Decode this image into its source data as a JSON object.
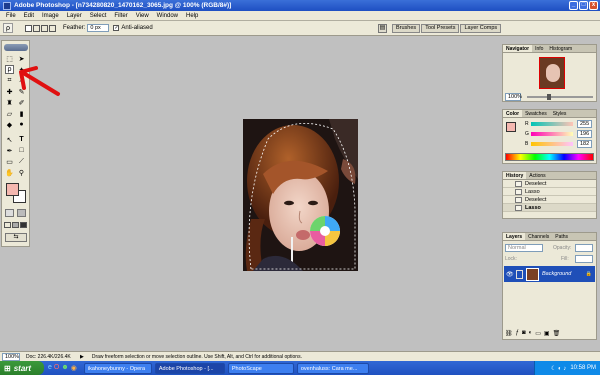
{
  "window": {
    "title": "Adobe Photoshop - [n734280820_1470162_3065.jpg @ 100% (RGB/8#)]",
    "min": "_",
    "max": "□",
    "close": "x"
  },
  "menu": [
    "File",
    "Edit",
    "Image",
    "Layer",
    "Select",
    "Filter",
    "View",
    "Window",
    "Help"
  ],
  "options": {
    "feather_label": "Feather:",
    "feather_value": "0 px",
    "antialias_label": "Anti-aliased",
    "antialias_checked": true,
    "tabs": [
      "Brushes",
      "Tool Presets",
      "Layer Comps"
    ]
  },
  "navigator": {
    "tabs": [
      "Navigator",
      "Info",
      "Histogram"
    ],
    "zoom": "100%"
  },
  "color": {
    "tabs": [
      "Color",
      "Swatches",
      "Styles"
    ],
    "foreground": "#f5b8b0",
    "channels": [
      {
        "label": "R",
        "value": "255"
      },
      {
        "label": "G",
        "value": "196"
      },
      {
        "label": "B",
        "value": "182"
      }
    ]
  },
  "history": {
    "tabs": [
      "History",
      "Actions"
    ],
    "items": [
      "Deselect",
      "Lasso",
      "Deselect",
      "Lasso"
    ],
    "selected_index": 3
  },
  "layers": {
    "tabs": [
      "Layers",
      "Channels",
      "Paths"
    ],
    "blend_mode": "Normal",
    "opacity_label": "Opacity:",
    "lock_label": "Lock:",
    "fill_label": "Fill:",
    "layer_name": "Background"
  },
  "status": {
    "zoom": "100%",
    "doc": "Doc: 226.4K/226.4K",
    "hint": "Draw freeform selection or move selection outline. Use Shift, Alt, and Ctrl for additional options."
  },
  "taskbar": {
    "start": "start",
    "tasks": [
      {
        "label": "ikahoneybunny - Opera",
        "active": false
      },
      {
        "label": "Adobe Photoshop - [...",
        "active": true
      },
      {
        "label": "PhotoScape",
        "active": false
      },
      {
        "label": "ovenhaluss: Cara me...",
        "active": false
      }
    ],
    "clock": "10:58 PM"
  },
  "colors": {
    "accent": "#1e4fc2",
    "panel": "#ece9d8",
    "workspace": "#c0c0c0",
    "annotation": "#e01010"
  }
}
